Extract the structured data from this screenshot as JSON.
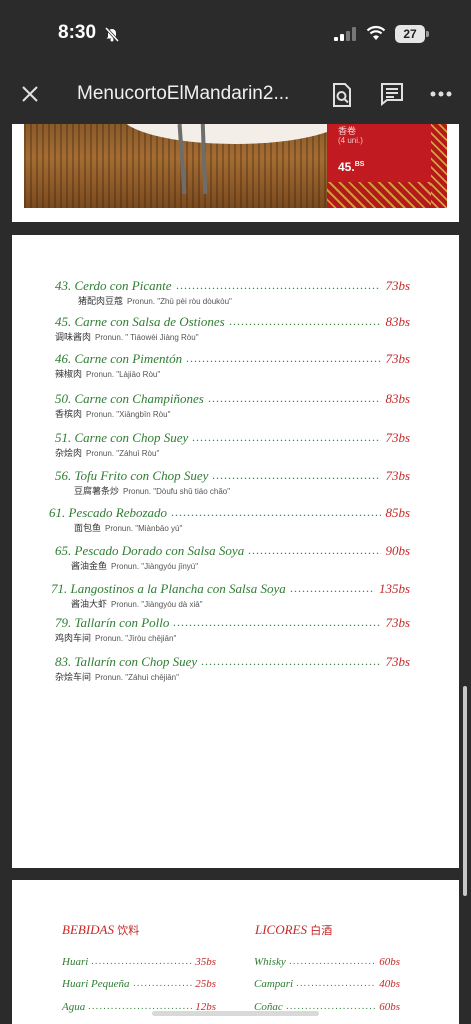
{
  "status_bar": {
    "time": "8:30",
    "battery": "27"
  },
  "toolbar": {
    "title": "MenucortoElMandarin2..."
  },
  "promo": {
    "name": "香卷",
    "qty": "(4 uni.)",
    "price": "45.",
    "currency": "BS"
  },
  "menu_items": [
    {
      "name": "43. Cerdo con Picante",
      "price": "73bs",
      "chinese": "猪配肉豆蔻",
      "pronun": "Pronun. \"Zhū pèi ròu dòukòu\""
    },
    {
      "name": "45. Carne con Salsa de Ostiones",
      "price": "83bs",
      "chinese": "调味酱肉",
      "pronun": "Pronun. \" Tiáowèi Jiàng Ròu\""
    },
    {
      "name": "46. Carne con Pimentón",
      "price": "73bs",
      "chinese": "辣椒肉",
      "pronun": "Pronun. \"Làjiāo Ròu\""
    },
    {
      "name": "50. Carne con Champiñones",
      "price": "83bs",
      "chinese": "香槟肉",
      "pronun": "Pronun. \"Xiāngbīn Ròu\""
    },
    {
      "name": "51. Carne con Chop Suey",
      "price": "73bs",
      "chinese": "杂烩肉",
      "pronun": "Pronun. \"Záhuì Ròu\""
    },
    {
      "name": "56. Tofu Frito con Chop Suey",
      "price": "73bs",
      "chinese": "豆腐薯条炒",
      "pronun": "Pronun. \"Dòufu shǔ tiáo chǎo\""
    },
    {
      "name": "61. Pescado Rebozado",
      "price": "85bs",
      "chinese": "面包鱼",
      "pronun": "Pronun. \"Miànbāo yú\""
    },
    {
      "name": "65. Pescado Dorado con Salsa Soya",
      "price": "90bs",
      "chinese": "酱油金鱼",
      "pronun": "Pronun. \"Jiàngyóu jīnyú\""
    },
    {
      "name": "71. Langostinos a la Plancha con Salsa Soya",
      "price": "135bs",
      "chinese": "酱油大虾",
      "pronun": "Pronun. \"Jiàngyóu dà xiā\""
    },
    {
      "name": "79. Tallarín con Pollo",
      "price": "73bs",
      "chinese": "鸡肉车间",
      "pronun": "Pronun. \"Jīròu chējiān\""
    },
    {
      "name": "83. Tallarín con Chop Suey",
      "price": "73bs",
      "chinese": "杂烩车间",
      "pronun": "Pronun. \"Záhuì chējiān\""
    }
  ],
  "drinks": {
    "bebidas": {
      "title": "BEBIDAS",
      "title_cn": "饮料",
      "items": [
        {
          "name": "Huari",
          "price": "35bs"
        },
        {
          "name": "Huari Pequeña",
          "price": "25bs"
        },
        {
          "name": "Agua",
          "price": "12bs"
        }
      ]
    },
    "licores": {
      "title": "LICORES",
      "title_cn": "白酒",
      "items": [
        {
          "name": "Whisky",
          "price": "60bs"
        },
        {
          "name": "Campari",
          "price": "40bs"
        },
        {
          "name": "Coñac",
          "price": "60bs"
        }
      ]
    }
  },
  "colors": {
    "dish_green": "#2e7d32",
    "price_red": "#c62828",
    "chrome": "#2b2b2b"
  }
}
